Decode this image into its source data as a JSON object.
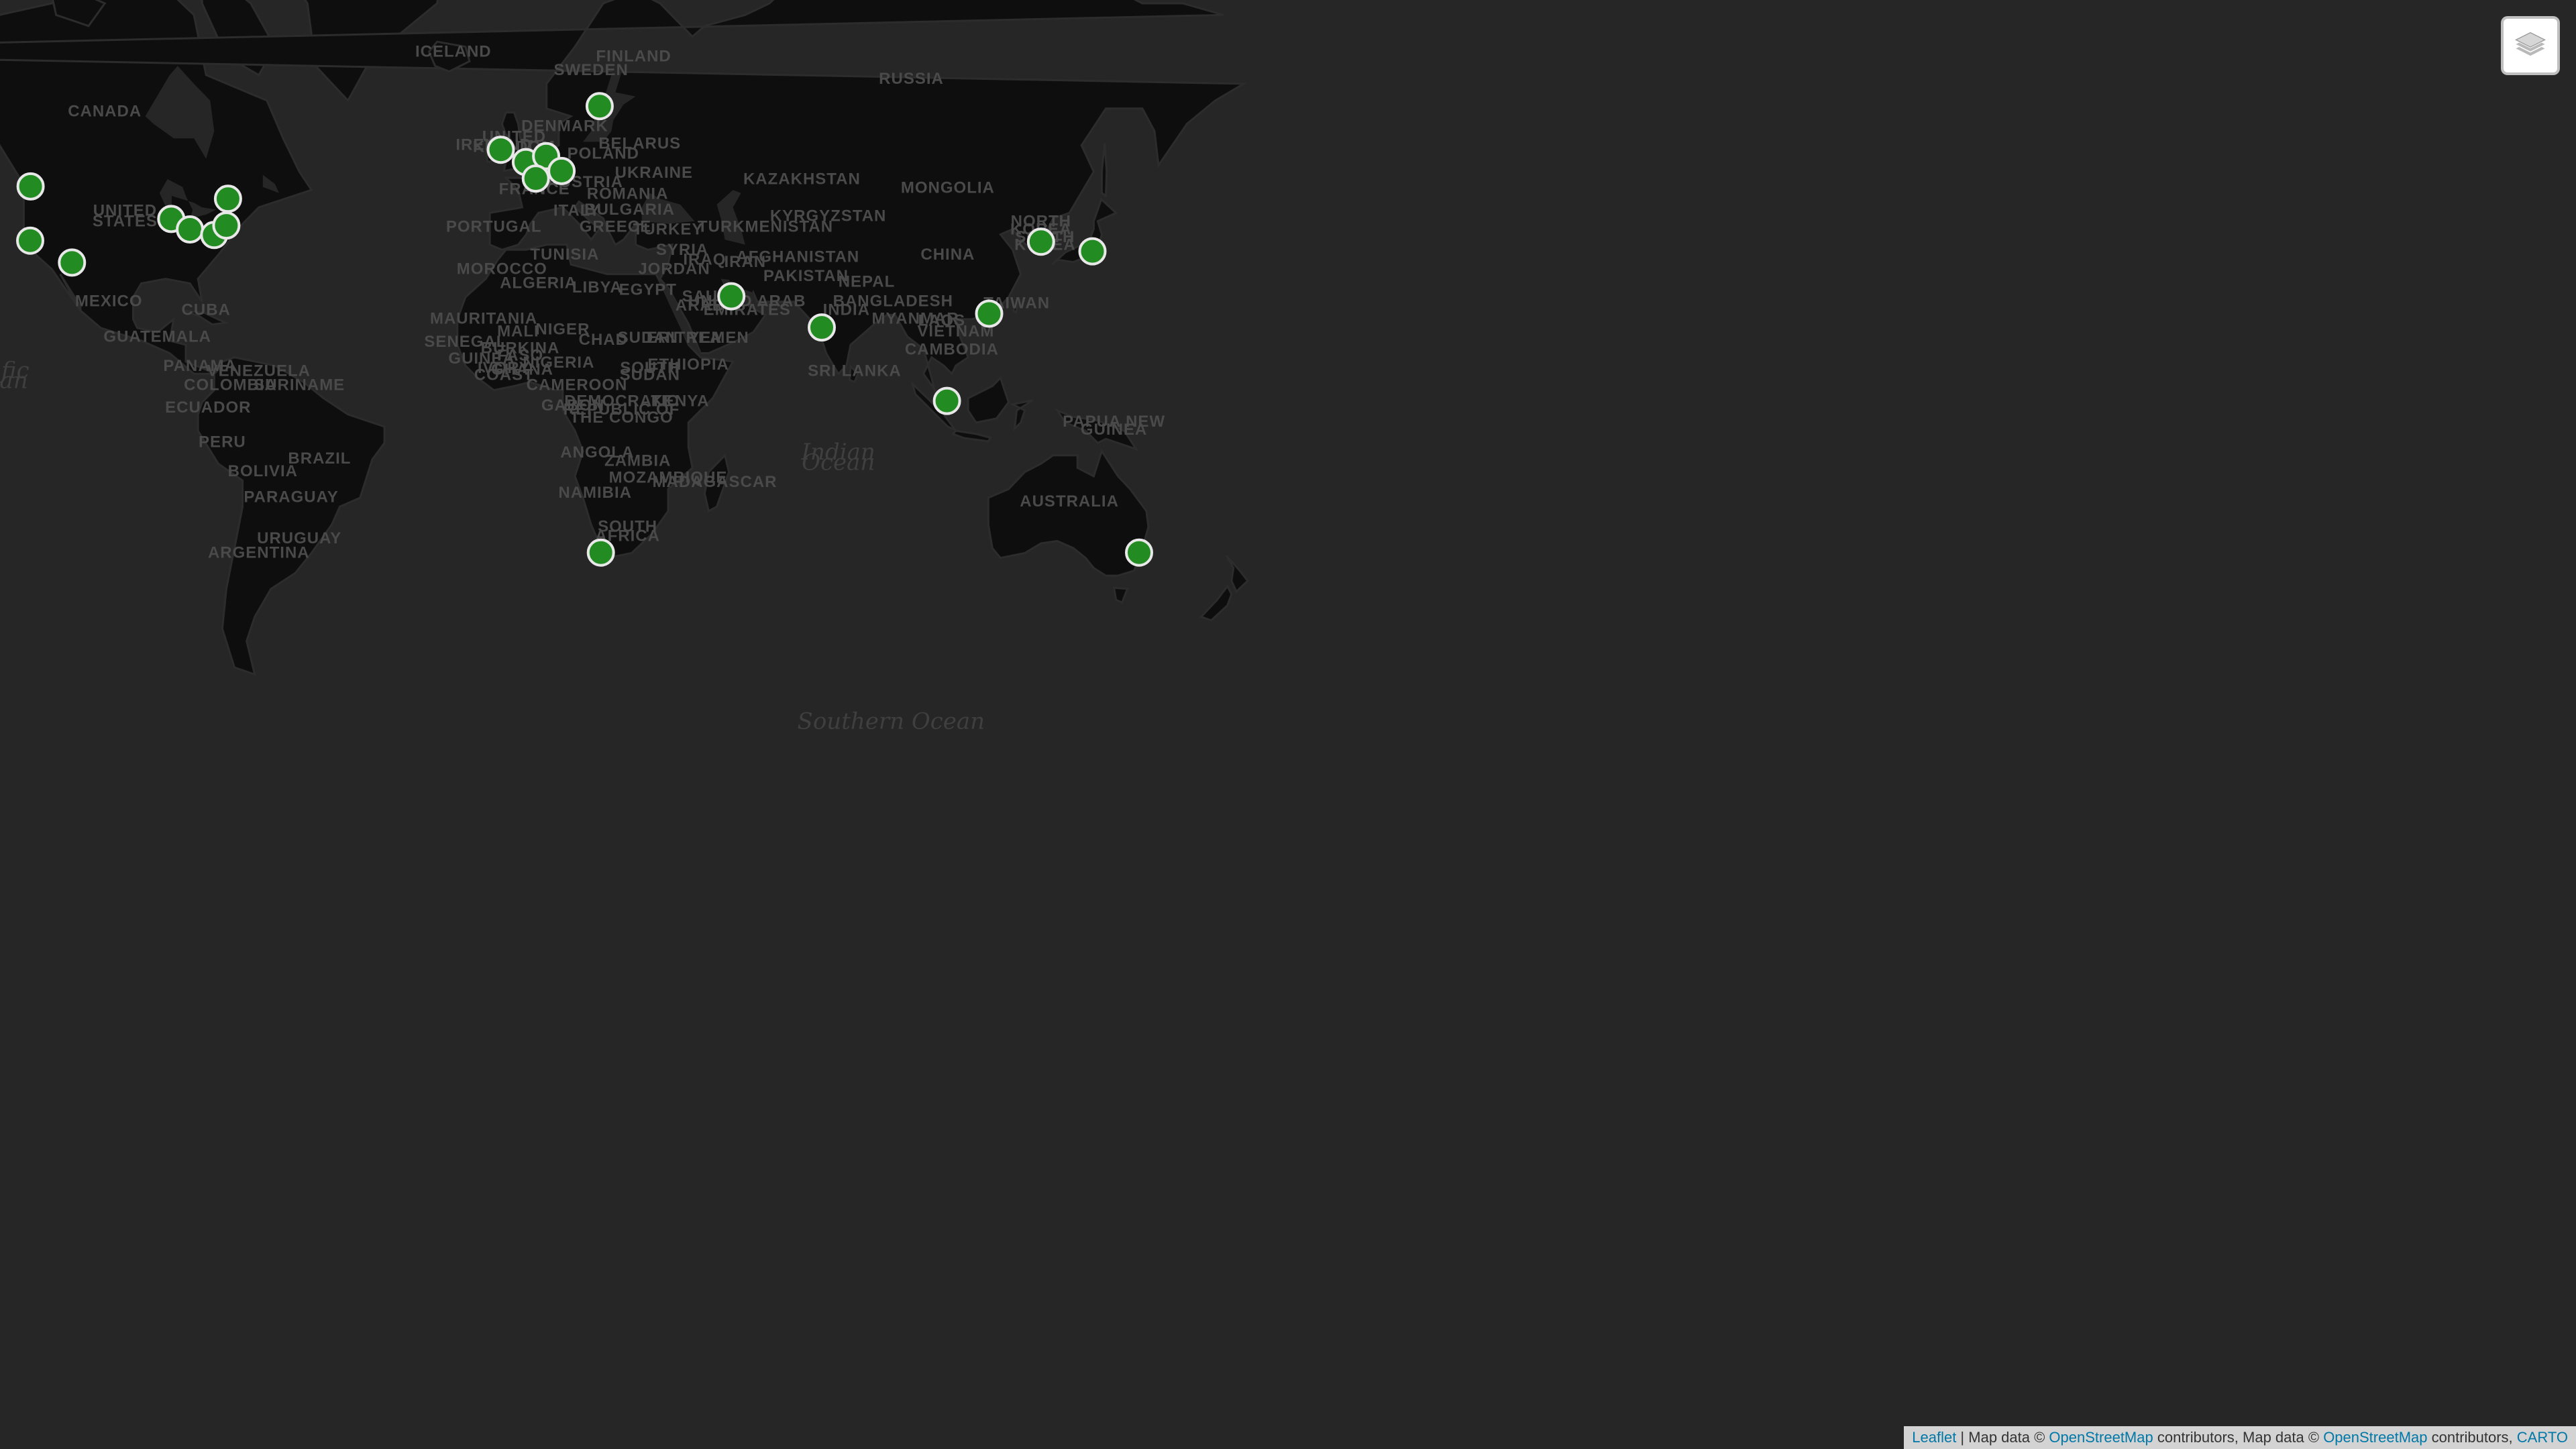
{
  "map": {
    "country_labels": [
      {
        "text": "CANADA",
        "lat": 58,
        "lon": -104
      },
      {
        "text": "UNITED",
        "lat": 42.5,
        "lon": -99
      },
      {
        "text": "STATES",
        "lat": 40.5,
        "lon": -99
      },
      {
        "text": "MEXICO",
        "lat": 24,
        "lon": -103
      },
      {
        "text": "GUATEMALA",
        "lat": 15.7,
        "lon": -91
      },
      {
        "text": "CUBA",
        "lat": 22,
        "lon": -79
      },
      {
        "text": "PANAMA",
        "lat": 8.7,
        "lon": -80.5
      },
      {
        "text": "VENEZUELA",
        "lat": 7.5,
        "lon": -66
      },
      {
        "text": "COLOMBIA",
        "lat": 4,
        "lon": -73
      },
      {
        "text": "SURINAME",
        "lat": 4,
        "lon": -56
      },
      {
        "text": "ECUADOR",
        "lat": -1.5,
        "lon": -78.5
      },
      {
        "text": "PERU",
        "lat": -10,
        "lon": -75
      },
      {
        "text": "BRAZIL",
        "lat": -14,
        "lon": -51
      },
      {
        "text": "BOLIVIA",
        "lat": -17,
        "lon": -65
      },
      {
        "text": "PARAGUAY",
        "lat": -23,
        "lon": -58
      },
      {
        "text": "URUGUAY",
        "lat": -32,
        "lon": -56
      },
      {
        "text": "ARGENTINA",
        "lat": -35,
        "lon": -66
      },
      {
        "text": "ICELAND",
        "lat": 65,
        "lon": -18
      },
      {
        "text": "UNITED",
        "lat": 54.5,
        "lon": -3
      },
      {
        "text": "KINGDOM",
        "lat": 53,
        "lon": -3
      },
      {
        "text": "IRELAND",
        "lat": 53.3,
        "lon": -8
      },
      {
        "text": "SWEDEN",
        "lat": 63,
        "lon": 16
      },
      {
        "text": "FINLAND",
        "lat": 64.5,
        "lon": 26.5
      },
      {
        "text": "DENMARK",
        "lat": 56,
        "lon": 9.5
      },
      {
        "text": "POLAND",
        "lat": 52,
        "lon": 19
      },
      {
        "text": "BELARUS",
        "lat": 53.5,
        "lon": 28
      },
      {
        "text": "UKRAINE",
        "lat": 49,
        "lon": 31.5
      },
      {
        "text": "FRANCE",
        "lat": 46.3,
        "lon": 2
      },
      {
        "text": "AUSTRIA",
        "lat": 47.5,
        "lon": 14.5
      },
      {
        "text": "ROMANIA",
        "lat": 45.5,
        "lon": 25
      },
      {
        "text": "BULGARIA",
        "lat": 42.7,
        "lon": 25.5
      },
      {
        "text": "ITALY",
        "lat": 42.5,
        "lon": 12.5
      },
      {
        "text": "GREECE",
        "lat": 39.5,
        "lon": 22
      },
      {
        "text": "PORTUGAL",
        "lat": 39.5,
        "lon": -8
      },
      {
        "text": "TURKEY",
        "lat": 39,
        "lon": 35
      },
      {
        "text": "SYRIA",
        "lat": 35,
        "lon": 38.5
      },
      {
        "text": "IRAQ",
        "lat": 33,
        "lon": 44
      },
      {
        "text": "JORDAN",
        "lat": 31,
        "lon": 36.5
      },
      {
        "text": "TUNISIA",
        "lat": 34,
        "lon": 9.5
      },
      {
        "text": "MOROCCO",
        "lat": 31,
        "lon": -6
      },
      {
        "text": "ALGERIA",
        "lat": 28,
        "lon": 3
      },
      {
        "text": "LIBYA",
        "lat": 27,
        "lon": 17.5
      },
      {
        "text": "EGYPT",
        "lat": 26.5,
        "lon": 30
      },
      {
        "text": "SAUDI",
        "lat": 25,
        "lon": 45
      },
      {
        "text": "ARABIA",
        "lat": 23,
        "lon": 45
      },
      {
        "text": "UNITED ARAB",
        "lat": 24,
        "lon": 54.5
      },
      {
        "text": "EMIRATES",
        "lat": 22,
        "lon": 54.5
      },
      {
        "text": "YEMEN",
        "lat": 15.5,
        "lon": 47.5
      },
      {
        "text": "ERITREA",
        "lat": 15.5,
        "lon": 39
      },
      {
        "text": "ETHIOPIA",
        "lat": 9,
        "lon": 40
      },
      {
        "text": "SUDAN",
        "lat": 15.5,
        "lon": 30
      },
      {
        "text": "SOUTH",
        "lat": 8.2,
        "lon": 30.5
      },
      {
        "text": "SUDAN",
        "lat": 6.5,
        "lon": 30.5
      },
      {
        "text": "CHAD",
        "lat": 15,
        "lon": 19
      },
      {
        "text": "NIGER",
        "lat": 17.5,
        "lon": 9
      },
      {
        "text": "MALI",
        "lat": 17,
        "lon": -2
      },
      {
        "text": "MAURITANIA",
        "lat": 20,
        "lon": -10.5
      },
      {
        "text": "SENEGAL",
        "lat": 14.5,
        "lon": -15
      },
      {
        "text": "GUINEA",
        "lat": 10.5,
        "lon": -11
      },
      {
        "text": "BURKINA",
        "lat": 13,
        "lon": -1.5
      },
      {
        "text": "FASO",
        "lat": 11.2,
        "lon": -1.5
      },
      {
        "text": "IVORY",
        "lat": 8.2,
        "lon": -5.5
      },
      {
        "text": "COAST",
        "lat": 6.5,
        "lon": -5.5
      },
      {
        "text": "GHANA",
        "lat": 7.8,
        "lon": -1
      },
      {
        "text": "NIGERIA",
        "lat": 9.5,
        "lon": 8
      },
      {
        "text": "CAMEROON",
        "lat": 4,
        "lon": 12.5
      },
      {
        "text": "GABON",
        "lat": -1,
        "lon": 11.5
      },
      {
        "text": "DEMOCRATIC",
        "lat": 0,
        "lon": 23.5
      },
      {
        "text": "REPUBLIC OF",
        "lat": -2,
        "lon": 23.5
      },
      {
        "text": "THE CONGO",
        "lat": -4,
        "lon": 23.5
      },
      {
        "text": "KENYA",
        "lat": 0,
        "lon": 38
      },
      {
        "text": "ANGOLA",
        "lat": -12.5,
        "lon": 17.5
      },
      {
        "text": "ZAMBIA",
        "lat": -14.5,
        "lon": 27.5
      },
      {
        "text": "MOZAMBIQUE",
        "lat": -18.5,
        "lon": 35
      },
      {
        "text": "NAMIBIA",
        "lat": -22,
        "lon": 17
      },
      {
        "text": "SOUTH",
        "lat": -29.5,
        "lon": 25
      },
      {
        "text": "AFRICA",
        "lat": -31.5,
        "lon": 25
      },
      {
        "text": "MADAGASCAR",
        "lat": -19.5,
        "lon": 46.5
      },
      {
        "text": "RUSSIA",
        "lat": 62,
        "lon": 95
      },
      {
        "text": "KAZAKHSTAN",
        "lat": 48,
        "lon": 68
      },
      {
        "text": "MONGOLIA",
        "lat": 46.5,
        "lon": 104
      },
      {
        "text": "TURKMENISTAN",
        "lat": 39.5,
        "lon": 59
      },
      {
        "text": "KYRGYZSTAN",
        "lat": 41.5,
        "lon": 74.5
      },
      {
        "text": "IRAN",
        "lat": 32.5,
        "lon": 54
      },
      {
        "text": "AFGHANISTAN",
        "lat": 33.5,
        "lon": 67
      },
      {
        "text": "PAKISTAN",
        "lat": 29.5,
        "lon": 69
      },
      {
        "text": "NEPAL",
        "lat": 28.3,
        "lon": 84
      },
      {
        "text": "INDIA",
        "lat": 22,
        "lon": 79
      },
      {
        "text": "BANGLADESH",
        "lat": 24,
        "lon": 90.5
      },
      {
        "text": "SRI LANKA",
        "lat": 7.5,
        "lon": 81
      },
      {
        "text": "CHINA",
        "lat": 34,
        "lon": 104
      },
      {
        "text": "NORTH",
        "lat": 40.5,
        "lon": 127
      },
      {
        "text": "KOREA",
        "lat": 39,
        "lon": 127
      },
      {
        "text": "SOUTH",
        "lat": 37.5,
        "lon": 128
      },
      {
        "text": "KOREA",
        "lat": 36,
        "lon": 128
      },
      {
        "text": "TAIWAN",
        "lat": 23.5,
        "lon": 121
      },
      {
        "text": "MYANMAR",
        "lat": 20,
        "lon": 96
      },
      {
        "text": "LAOS",
        "lat": 19.5,
        "lon": 102.5
      },
      {
        "text": "VIETNAM",
        "lat": 17,
        "lon": 106
      },
      {
        "text": "CAMBODIA",
        "lat": 12.7,
        "lon": 105
      },
      {
        "text": "PAPUA NEW",
        "lat": -5,
        "lon": 145
      },
      {
        "text": "GUINEA",
        "lat": -7,
        "lon": 145
      },
      {
        "text": "AUSTRALIA",
        "lat": -24,
        "lon": 134
      }
    ],
    "ocean_labels": [
      {
        "text": "Pacific",
        "lat": 7,
        "lon": -132
      },
      {
        "text": "Ocean",
        "lat": 4.5,
        "lon": -132
      },
      {
        "text": "Indian",
        "lat": -13,
        "lon": 77
      },
      {
        "text": "Ocean",
        "lat": -15.5,
        "lon": 77
      },
      {
        "text": "Southern Ocean",
        "lat": -62,
        "lon": 90
      }
    ],
    "markers": [
      {
        "name": "Seattle",
        "lat": 47.6,
        "lon": -122.3
      },
      {
        "name": "San Francisco",
        "lat": 37.8,
        "lon": -122.4
      },
      {
        "name": "Phoenix",
        "lat": 33.4,
        "lon": -112.1
      },
      {
        "name": "Chicago",
        "lat": 41.9,
        "lon": -87.6
      },
      {
        "name": "Columbus",
        "lat": 39.96,
        "lon": -83.0
      },
      {
        "name": "Washington",
        "lat": 38.9,
        "lon": -77.0
      },
      {
        "name": "New York",
        "lat": 40.7,
        "lon": -74.0
      },
      {
        "name": "Montreal",
        "lat": 45.5,
        "lon": -73.6
      },
      {
        "name": "Dublin",
        "lat": 53.35,
        "lon": -6.3
      },
      {
        "name": "London",
        "lat": 51.5,
        "lon": -0.1
      },
      {
        "name": "Amsterdam",
        "lat": 52.4,
        "lon": 4.9
      },
      {
        "name": "Paris",
        "lat": 48.9,
        "lon": 2.35
      },
      {
        "name": "Frankfurt",
        "lat": 50.1,
        "lon": 8.7
      },
      {
        "name": "Stockholm",
        "lat": 59.3,
        "lon": 18.1
      },
      {
        "name": "Cape Town",
        "lat": -33.9,
        "lon": 18.4
      },
      {
        "name": "Bahrain",
        "lat": 26.2,
        "lon": 50.6
      },
      {
        "name": "Mumbai",
        "lat": 19.1,
        "lon": 72.9
      },
      {
        "name": "Singapore",
        "lat": 1.35,
        "lon": 103.8
      },
      {
        "name": "Hong Kong",
        "lat": 22.3,
        "lon": 114.2
      },
      {
        "name": "Seoul",
        "lat": 37.6,
        "lon": 127.0
      },
      {
        "name": "Tokyo",
        "lat": 35.7,
        "lon": 139.7
      },
      {
        "name": "Sydney",
        "lat": -33.9,
        "lon": 151.2
      }
    ],
    "marker_color": "#228B22",
    "land_color": "#0e0e0e",
    "water_color": "#262626"
  },
  "controls": {
    "layers_icon": "layers-icon"
  },
  "attribution": {
    "leaflet": "Leaflet",
    "sep": " | Map data © ",
    "osm1": "OpenStreetMap",
    "mid": " contributors, Map data © ",
    "osm2": "OpenStreetMap",
    "mid2": " contributors, ",
    "carto": "CARTO"
  }
}
